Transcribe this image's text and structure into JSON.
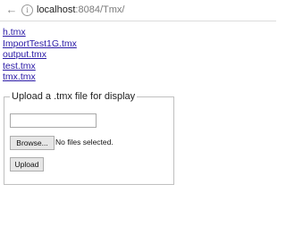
{
  "browser": {
    "url_host": "localhost",
    "url_rest": ":8084/Tmx/",
    "back_icon": "arrow-left-icon",
    "info_icon": "info-circle-icon"
  },
  "files": [
    {
      "label": "h.tmx"
    },
    {
      "label": "ImportTest1G.tmx"
    },
    {
      "label": "output.tmx"
    },
    {
      "label": "test.tmx"
    },
    {
      "label": "tmx.tmx"
    }
  ],
  "upload_form": {
    "legend": "Upload a .tmx file for display",
    "text_value": "",
    "browse_label": "Browse...",
    "file_status": "No files selected.",
    "submit_label": "Upload"
  },
  "colors": {
    "link": "#2a1aa6",
    "button_bg": "#e6e6e6",
    "fieldset_border": "#c0c0c0"
  }
}
